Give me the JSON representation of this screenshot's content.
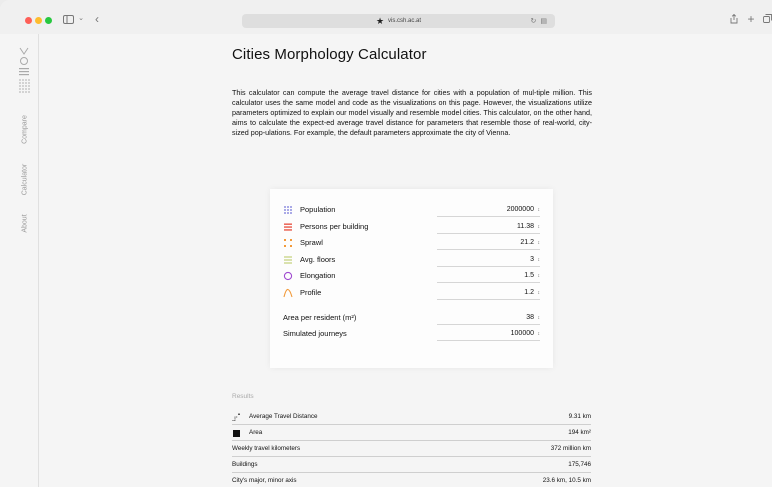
{
  "browser": {
    "url": "vis.csh.ac.at"
  },
  "sidebar": {
    "items": [
      {
        "label": "Compare"
      },
      {
        "label": "Calculator"
      },
      {
        "label": "About"
      }
    ]
  },
  "page": {
    "title": "Cities Morphology Calculator",
    "intro": "This calculator can compute the average travel distance for cities with a population of mul-tiple million. This calculator uses the same model and code as the visualizations on this page. However, the visualizations utilize parameters optimized to explain our model visually and resemble model cities. This calculator, on the other hand, aims to calculate the expect-ed average travel distance for parameters that resemble those of real-world, city-sized pop-ulations. For example, the default parameters approximate the city of Vienna."
  },
  "params": [
    {
      "label": "Population",
      "value": "2000000",
      "icon": "population-grid-icon",
      "color": "#6f6fd8"
    },
    {
      "label": "Persons per building",
      "value": "11.38",
      "icon": "building-lines-icon",
      "color": "#e84a3a"
    },
    {
      "label": "Sprawl",
      "value": "21.2",
      "icon": "sprawl-dots-icon",
      "color": "#f29a3a"
    },
    {
      "label": "Avg. floors",
      "value": "3",
      "icon": "floors-lines-icon",
      "color": "#b8c860"
    },
    {
      "label": "Elongation",
      "value": "1.5",
      "icon": "elongation-circle-icon",
      "color": "#a04bd0"
    },
    {
      "label": "Profile",
      "value": "1.2",
      "icon": "profile-curve-icon",
      "color": "#f29a3a"
    },
    {
      "label": "Area per resident (m²)",
      "value": "38"
    },
    {
      "label": "Simulated journeys",
      "value": "100000"
    }
  ],
  "results": {
    "heading": "Results",
    "rows": [
      {
        "label": "Average Travel Distance",
        "value": "9.31 km",
        "icon": "travel-path-icon"
      },
      {
        "label": "Area",
        "value": "194 km²",
        "icon": "area-square-icon"
      },
      {
        "label": "Weekly travel kilometers",
        "value": "372 million km"
      },
      {
        "label": "Buildings",
        "value": "175,746"
      },
      {
        "label": "City's major, minor axis",
        "value": "23.6 km, 10.5 km"
      }
    ]
  }
}
